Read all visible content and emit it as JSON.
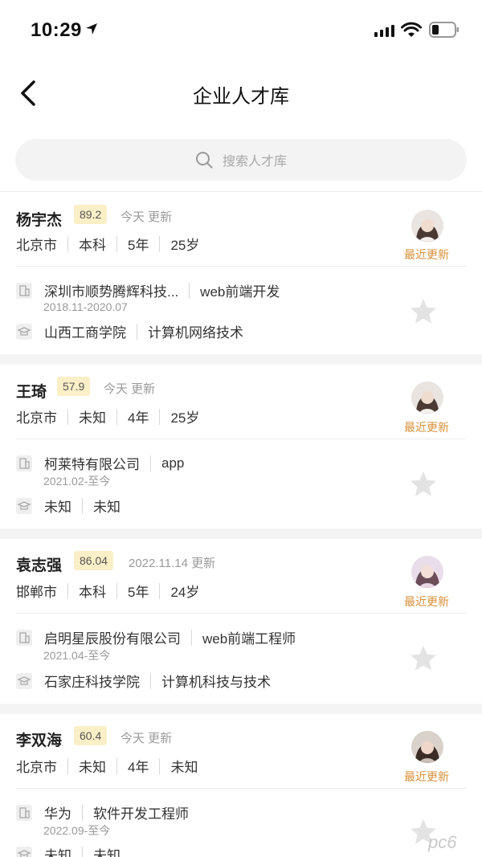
{
  "status_bar": {
    "time": "10:29"
  },
  "header": {
    "title": "企业人才库"
  },
  "search": {
    "placeholder": "搜索人才库"
  },
  "candidates": [
    {
      "name": "杨宇杰",
      "score": "89.2",
      "updated": "今天 更新",
      "meta": [
        "北京市",
        "本科",
        "5年",
        "25岁"
      ],
      "company": "深圳市顺势腾辉科技...",
      "position": "web前端开发",
      "period": "2018.11-2020.07",
      "school": "山西工商学院",
      "major": "计算机网络技术",
      "badge": "最近更新"
    },
    {
      "name": "王琦",
      "score": "57.9",
      "updated": "今天 更新",
      "meta": [
        "北京市",
        "未知",
        "4年",
        "25岁"
      ],
      "company": "柯莱特有限公司",
      "position": "app",
      "period": "2021.02-至今",
      "school": "未知",
      "major": "未知",
      "badge": "最近更新"
    },
    {
      "name": "袁志强",
      "score": "86.04",
      "updated": "2022.11.14 更新",
      "meta": [
        "邯郸市",
        "本科",
        "5年",
        "24岁"
      ],
      "company": "启明星辰股份有限公司",
      "position": "web前端工程师",
      "period": "2021.04-至今",
      "school": "石家庄科技学院",
      "major": "计算机科技与技术",
      "badge": "最近更新"
    },
    {
      "name": "李双海",
      "score": "60.4",
      "updated": "今天 更新",
      "meta": [
        "北京市",
        "未知",
        "4年",
        "未知"
      ],
      "company": "华为",
      "position": "软件开发工程师",
      "period": "2022.09-至今",
      "school": "未知",
      "major": "未知",
      "badge": "最近更新"
    }
  ],
  "watermark": "pc6",
  "colors": {
    "accent": "#d8903a",
    "score_bg": "#fbefc7",
    "page_bg": "#ffffff",
    "separator": "#f4f4f4"
  }
}
